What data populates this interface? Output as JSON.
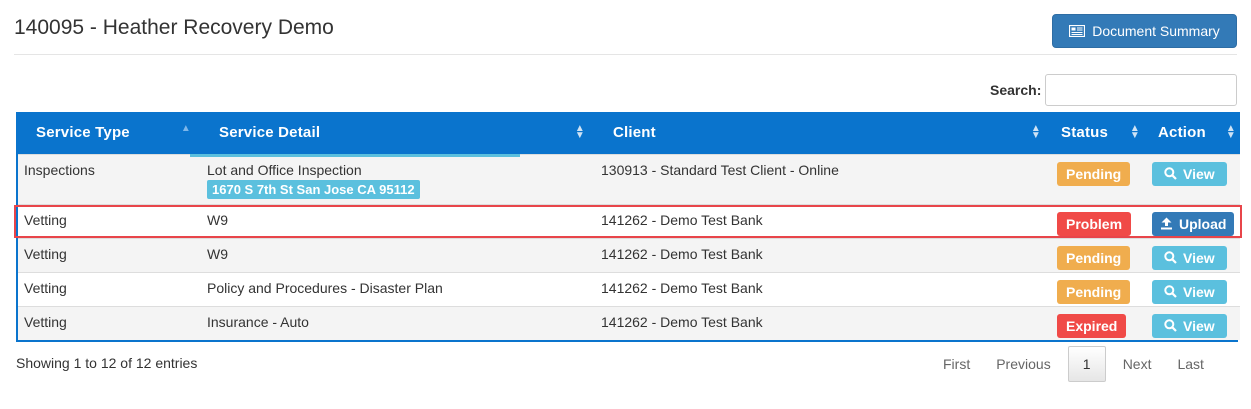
{
  "header": {
    "title": "140095 - Heather Recovery Demo",
    "doc_summary_label": "Document Summary"
  },
  "search": {
    "label": "Search:",
    "value": "",
    "placeholder": ""
  },
  "table": {
    "columns": [
      "Service Type",
      "Service Detail",
      "Client",
      "Status",
      "Action"
    ],
    "sorted_column": "Service Type",
    "rows": [
      {
        "service_type": "Inspections",
        "service_detail": "Lot and Office Inspection",
        "address": "1670 S 7th St San Jose CA 95112",
        "client": "130913 - Standard Test Client - Online",
        "status": "Pending",
        "action": "View"
      },
      {
        "service_type": "Vetting",
        "service_detail": "W9",
        "client": "141262 - Demo Test Bank",
        "status": "Problem",
        "action": "Upload"
      },
      {
        "service_type": "Vetting",
        "service_detail": "W9",
        "client": "141262 - Demo Test Bank",
        "status": "Pending",
        "action": "View"
      },
      {
        "service_type": "Vetting",
        "service_detail": "Policy and Procedures - Disaster Plan",
        "client": "141262 - Demo Test Bank",
        "status": "Pending",
        "action": "View"
      },
      {
        "service_type": "Vetting",
        "service_detail": "Insurance - Auto",
        "client": "141262 - Demo Test Bank",
        "status": "Expired",
        "action": "View"
      }
    ]
  },
  "footer": {
    "info": "Showing 1 to 12 of 12 entries",
    "pagination": {
      "first": "First",
      "previous": "Previous",
      "current": "1",
      "next": "Next",
      "last": "Last"
    }
  },
  "colors": {
    "header_blue": "#0a74cd",
    "primary": "#337ab7",
    "info": "#5bc0de",
    "warning": "#f0ad4e",
    "danger": "#f04a47"
  }
}
